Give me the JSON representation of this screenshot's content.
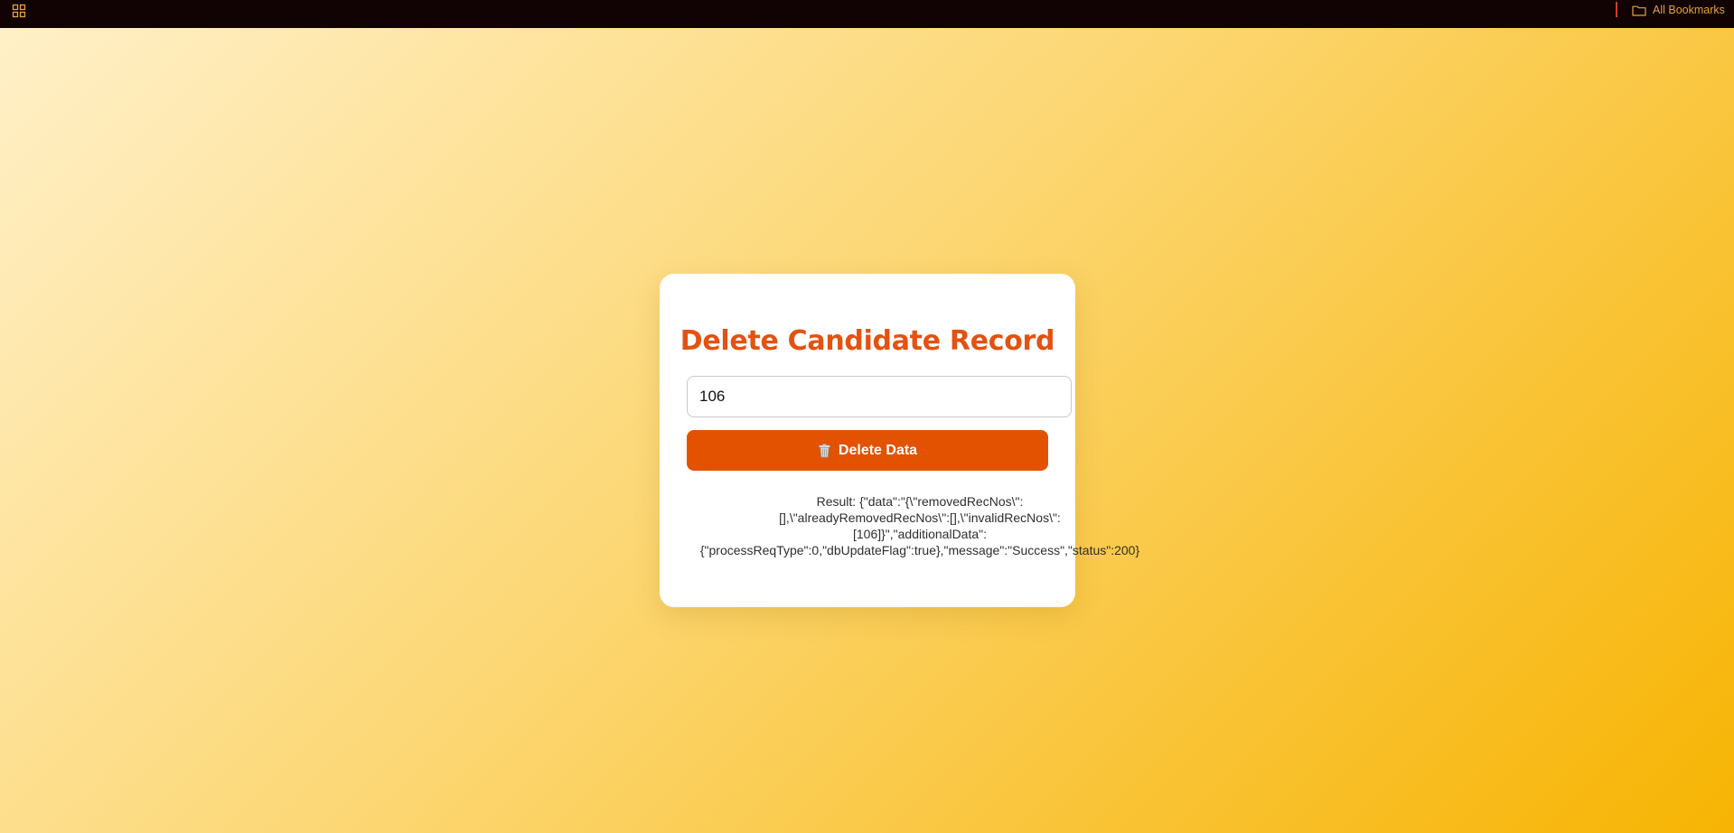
{
  "browser": {
    "apps_icon": "grid-apps-icon",
    "bookmarks": {
      "icon": "folder-icon",
      "label": "All Bookmarks"
    }
  },
  "colors": {
    "topbar": "#110203",
    "accent": "#e35211",
    "button": "#e35200",
    "bookmarks_text": "#e8a23b",
    "gradient_start": "#fff0c8",
    "gradient_end": "#f7b403"
  },
  "form": {
    "title": "Delete Candidate Record",
    "input": {
      "value": "106",
      "placeholder": ""
    },
    "delete_button": {
      "icon": "trash-can-icon",
      "label": "Delete Data"
    },
    "result": {
      "lines": [
        "Result: {\"data\":\"{\\\"removedRecNos\\\":",
        "[],\\\"alreadyRemovedRecNos\\\":[],\\\"invalidRecNos\\\":",
        "[106]}\",\"additionalData\":",
        "{\"processReqType\":0,\"dbUpdateFlag\":true},\"message\":\"Success\",\"status\":200}"
      ]
    }
  }
}
